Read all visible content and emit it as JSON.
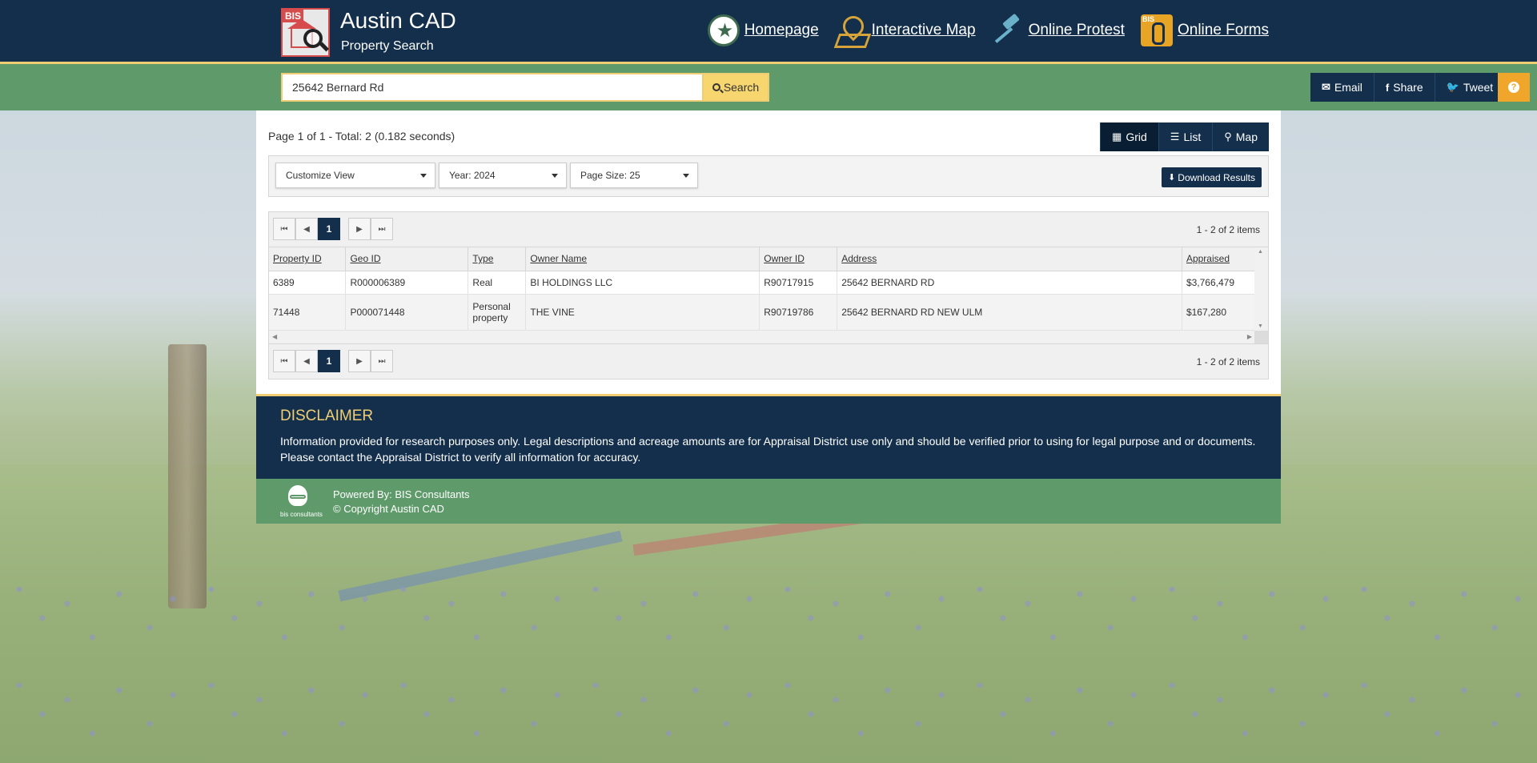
{
  "header": {
    "title": "Austin CAD",
    "subtitle": "Property Search",
    "logo_text": "BIS",
    "nav": [
      {
        "label": "Homepage",
        "icon": "star-badge-icon"
      },
      {
        "label": "Interactive Map",
        "icon": "map-pin-icon"
      },
      {
        "label": "Online Protest",
        "icon": "gavel-icon"
      },
      {
        "label": "Online Forms",
        "icon": "paperclip-forms-icon"
      }
    ]
  },
  "search": {
    "value": "25642 Bernard Rd",
    "button_label": "Search"
  },
  "share": {
    "email": "Email",
    "share": "Share",
    "tweet": "Tweet",
    "help_icon": "?"
  },
  "results": {
    "summary": "Page 1 of 1 - Total: 2 (0.182 seconds)",
    "view_toggle": {
      "grid": "Grid",
      "list": "List",
      "map": "Map"
    },
    "filters": {
      "customize": "Customize View",
      "year": "Year: 2024",
      "page_size": "Page Size: 25",
      "download": "Download Results"
    },
    "pager": {
      "current_page": "1",
      "info": "1 - 2 of 2 items"
    },
    "columns": [
      "Property ID",
      "Geo ID",
      "Type",
      "Owner Name",
      "Owner ID",
      "Address",
      "Appraised"
    ],
    "rows": [
      [
        "6389",
        "R000006389",
        "Real",
        "BI HOLDINGS LLC",
        "R90717915",
        "25642 BERNARD RD",
        "$3,766,479"
      ],
      [
        "71448",
        "P000071448",
        "Personal property",
        "THE VINE",
        "R90719786",
        "25642 BERNARD RD NEW ULM",
        "$167,280"
      ]
    ]
  },
  "disclaimer": {
    "title": "DISCLAIMER",
    "text": "Information provided for research purposes only. Legal descriptions and acreage amounts are for Appraisal District use only and should be verified prior to using for legal purpose and or documents. Please contact the Appraisal District to verify all information for accuracy."
  },
  "footer": {
    "logo_label": "bis consultants",
    "powered_by": "Powered By: BIS Consultants",
    "copyright": "© Copyright Austin CAD"
  },
  "colors": {
    "navy": "#132f4c",
    "green": "#5f9a6a",
    "gold": "#f0cd73",
    "orange": "#f0a52b"
  }
}
